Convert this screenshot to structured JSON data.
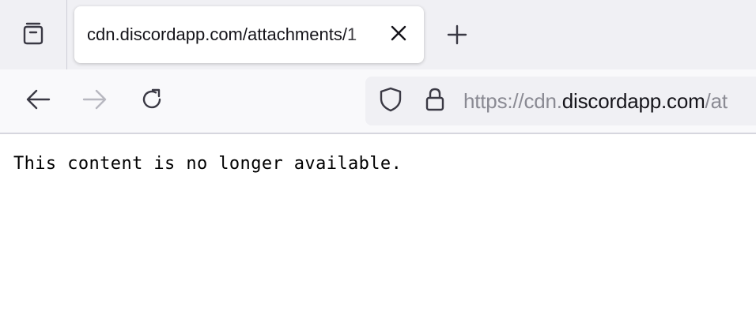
{
  "tab": {
    "title": "cdn.discordapp.com/attachments/1"
  },
  "urlbar": {
    "scheme": "https://",
    "subdomain": "cdn.",
    "domain": "discordapp.com",
    "path": "/at"
  },
  "page": {
    "message": "This content is no longer available."
  },
  "icons": {
    "tab_list": "tab-list-icon",
    "close": "close-icon",
    "new_tab": "plus-icon",
    "back": "back-arrow-icon",
    "forward": "forward-arrow-icon",
    "reload": "reload-icon",
    "tracking": "shield-icon",
    "security": "lock-icon"
  },
  "colors": {
    "tabstrip_bg": "#f0f0f4",
    "navbar_bg": "#f9f9fb",
    "url_dim": "#8a8a93",
    "url_main": "#15141a",
    "forward_disabled": "#b8b8c0"
  }
}
